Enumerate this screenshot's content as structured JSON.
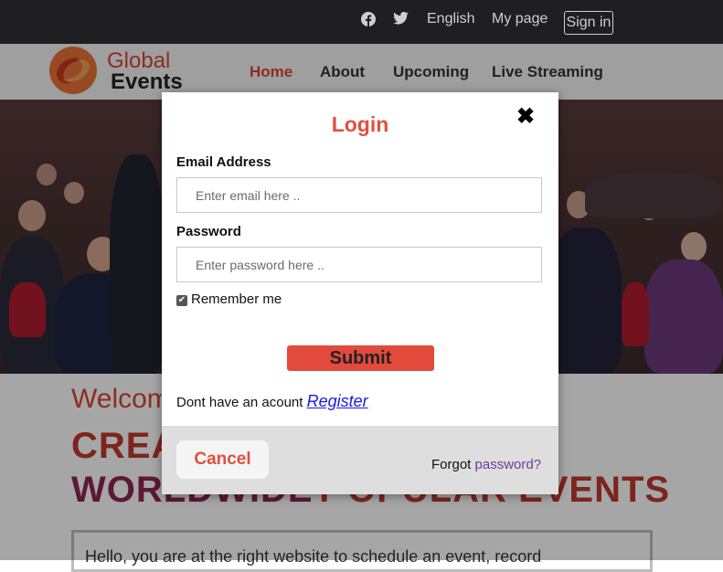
{
  "topbar": {
    "language": "English",
    "my_page": "My page",
    "sign_in": "Sign in"
  },
  "brand": {
    "line1": "Global",
    "line2": "Events",
    "accent": "#d9452f"
  },
  "nav": {
    "items": [
      "Home",
      "About",
      "Upcoming",
      "Live Streaming"
    ],
    "active": "Home"
  },
  "content": {
    "welcome": "Welcom",
    "headline1": "CREA",
    "headline2_a": "WORL",
    "headline2_b": "DWIDE",
    "headline2_c": "T OPULAR EVENTS",
    "box_text": "Hello, you are at the right website to schedule an event, record"
  },
  "modal": {
    "title": "Login",
    "close": "✖",
    "email_label": "Email Address",
    "email_placeholder": "Enter email here ..",
    "password_label": "Password",
    "password_placeholder": "Enter password here ..",
    "remember_label": "Remember me",
    "remember_checked": true,
    "submit": "Submit",
    "register_prompt": "Dont have an acount",
    "register_link": "Register",
    "cancel": "Cancel",
    "forgot_prefix": "Forgot",
    "forgot_link": "password?"
  }
}
